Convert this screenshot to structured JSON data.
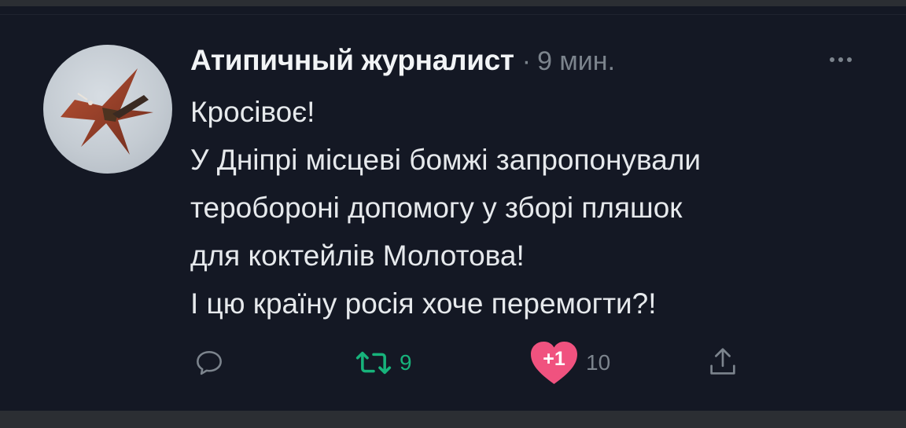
{
  "tweet": {
    "author_name": "Атипичный журналист",
    "separator": "·",
    "time": "9 мин.",
    "lines": [
      "Кросівоє!",
      "У Дніпрі місцеві бомжі запропонували",
      "тероборонi допомогу у зборі пляшок",
      "для коктейлів Молотова!",
      "І цю країну росія хоче перемогти?!"
    ],
    "retweet_count": "9",
    "like_badge": "+1",
    "like_count": "10"
  },
  "icons": {
    "reply": "reply-icon",
    "retweet": "retweet-icon",
    "like": "heart-icon",
    "share": "share-icon",
    "more": "more-icon"
  },
  "colors": {
    "background": "#141824",
    "retweet": "#17b37b",
    "like": "#f0527f",
    "muted": "#7c848d"
  }
}
